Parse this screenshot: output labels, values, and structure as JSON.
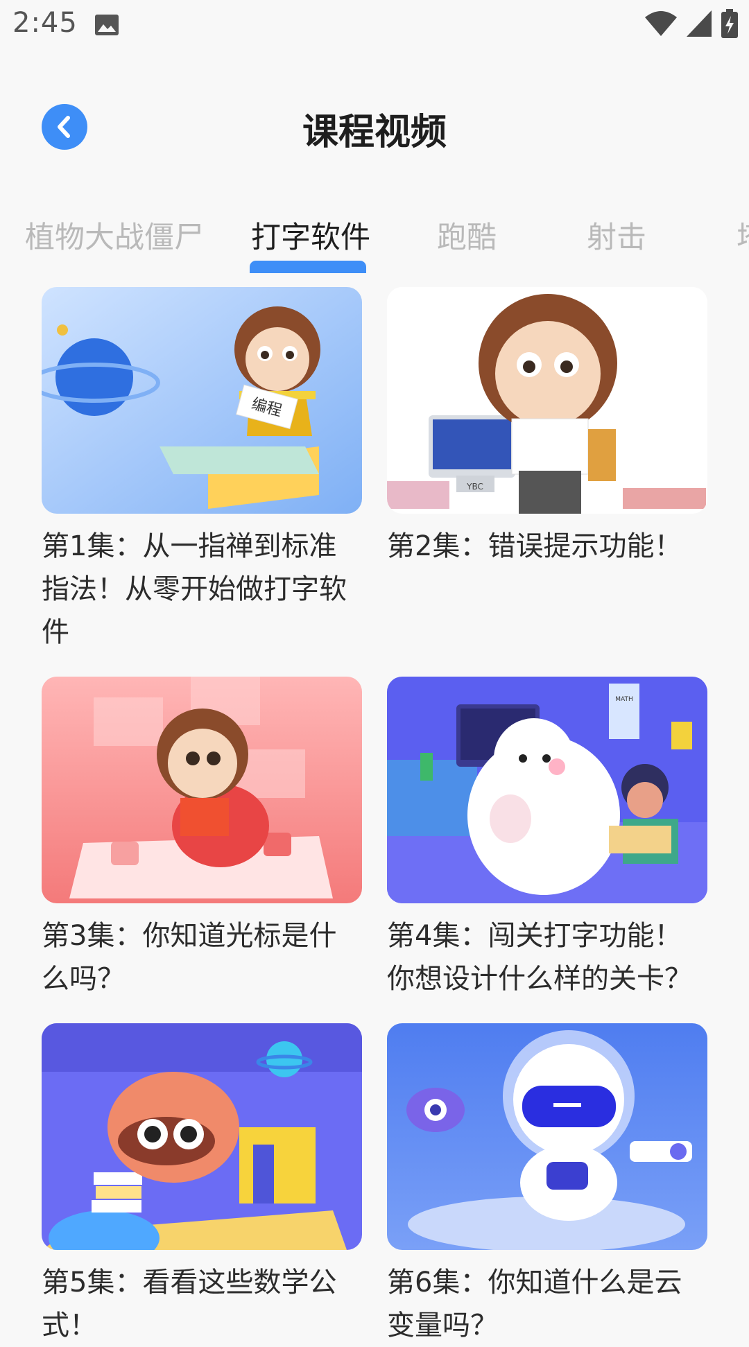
{
  "status_bar": {
    "time": "2:45",
    "icons": [
      "image-icon",
      "wifi-icon",
      "signal-icon",
      "battery-charging-icon"
    ]
  },
  "header": {
    "title": "课程视频",
    "back_icon": "chevron-left-icon"
  },
  "tabs": [
    {
      "label": "植物大战僵尸",
      "active": false
    },
    {
      "label": "打字软件",
      "active": true
    },
    {
      "label": "跑酷",
      "active": false
    },
    {
      "label": "射击",
      "active": false
    },
    {
      "label": "塔",
      "active": false
    }
  ],
  "colors": {
    "accent": "#3e8ef7",
    "title": "#1e1e1e",
    "tab_inactive": "#b9b9b9",
    "background": "#f8f8f8"
  },
  "episodes": [
    {
      "title": "第1集：从一指禅到标准指法！从零开始做打字软件",
      "thumb_sign": "编程"
    },
    {
      "title": "第2集：错误提示功能！",
      "thumb_sign": "YBC"
    },
    {
      "title": "第3集：你知道光标是什么吗？"
    },
    {
      "title": "第4集：闯关打字功能！你想设计什么样的关卡？",
      "thumb_sign": "MATH"
    },
    {
      "title": "第5集：看看这些数学公式！"
    },
    {
      "title": "第6集：你知道什么是云变量吗？"
    }
  ]
}
